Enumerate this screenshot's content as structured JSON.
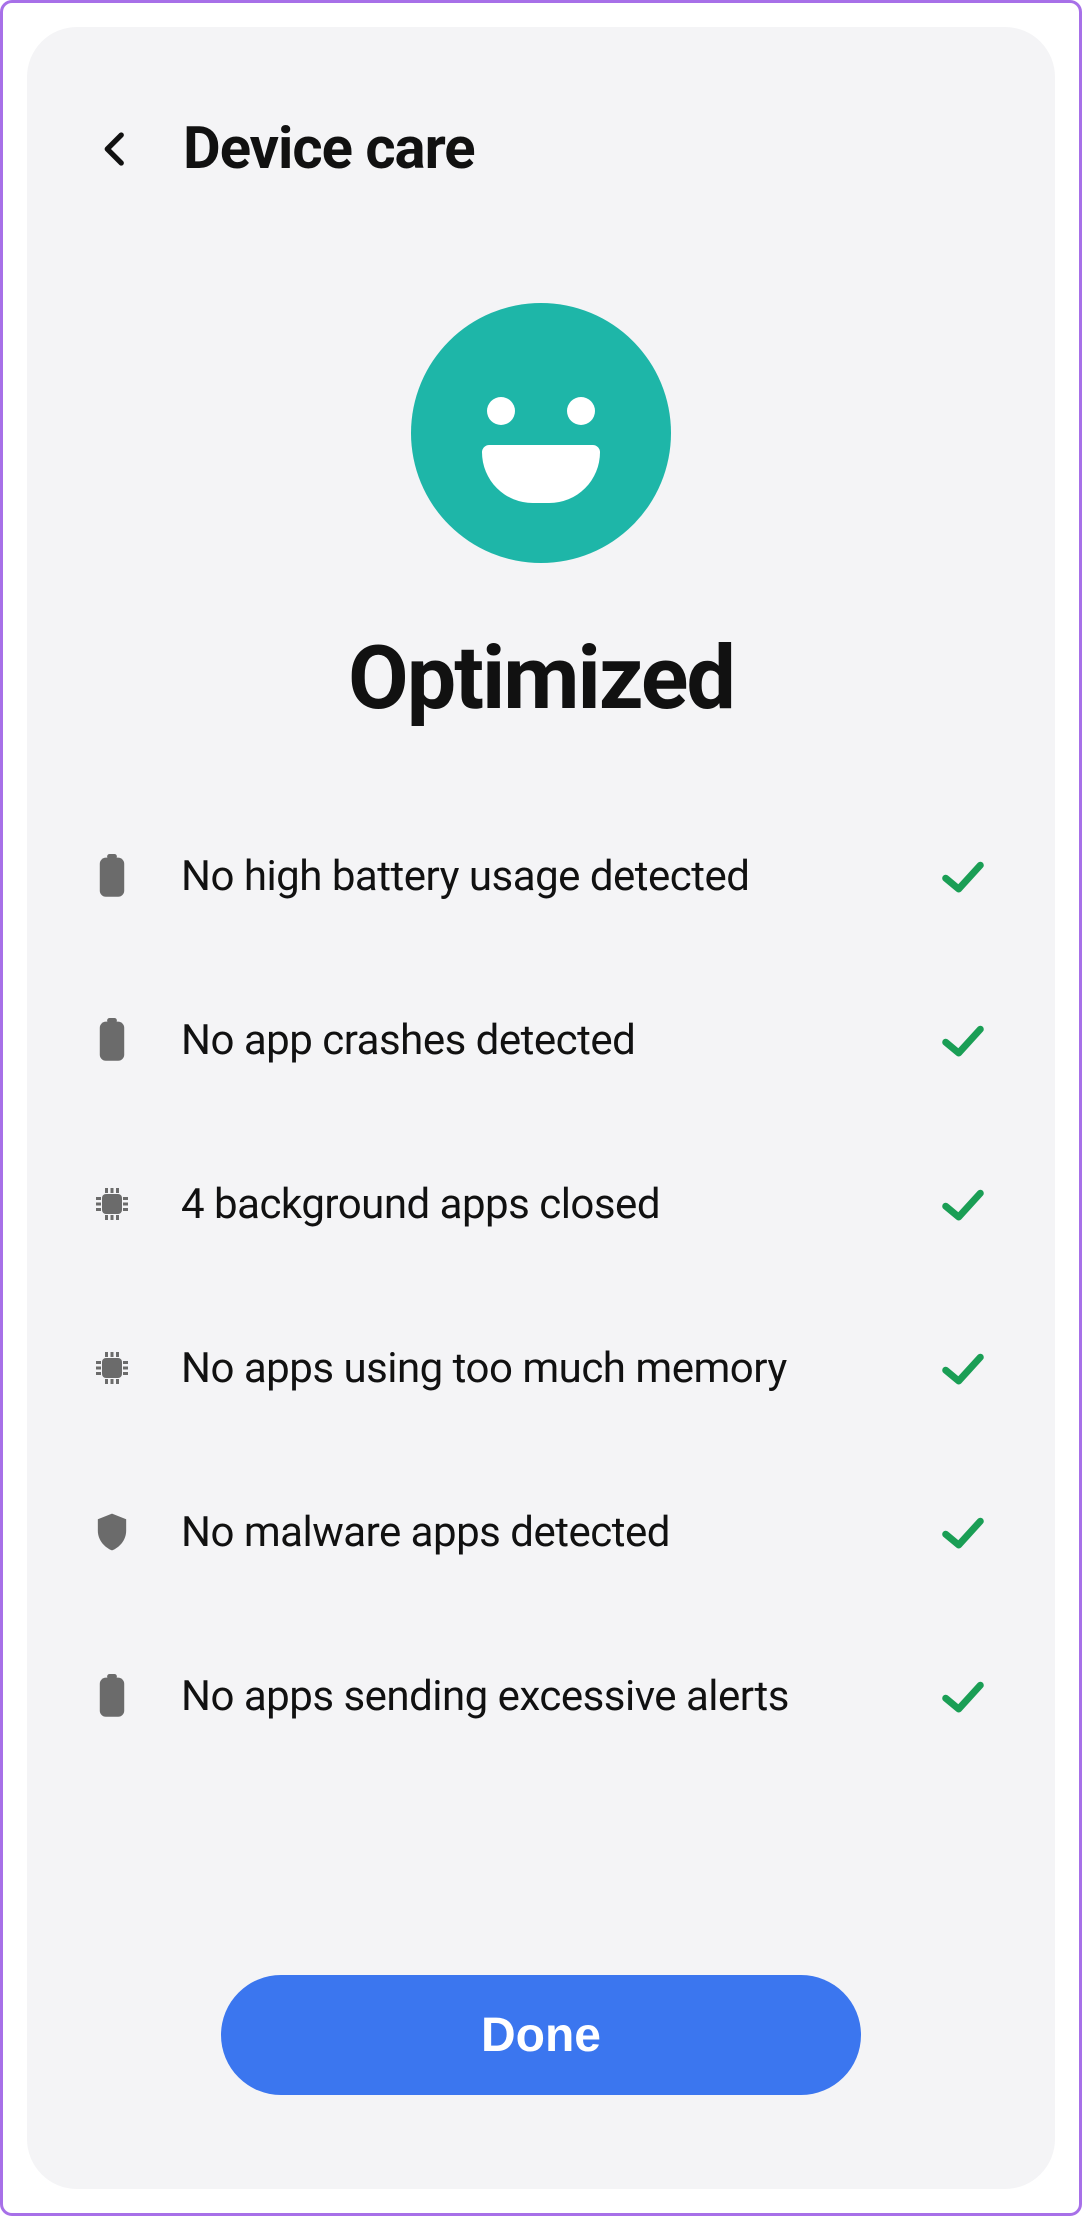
{
  "header": {
    "title": "Device care"
  },
  "status": {
    "title": "Optimized"
  },
  "items": [
    {
      "icon": "battery-icon",
      "label": "No high battery usage detected"
    },
    {
      "icon": "battery-icon",
      "label": "No app crashes detected"
    },
    {
      "icon": "chip-icon",
      "label": "4 background apps closed"
    },
    {
      "icon": "chip-icon",
      "label": "No apps using too much memory"
    },
    {
      "icon": "shield-icon",
      "label": "No malware apps detected"
    },
    {
      "icon": "battery-icon",
      "label": "No apps sending excessive alerts"
    }
  ],
  "actions": {
    "done": "Done"
  },
  "colors": {
    "accent": "#3b76ef",
    "face": "#1eb6a8",
    "check": "#1a9e55",
    "border": "#a770e8"
  }
}
